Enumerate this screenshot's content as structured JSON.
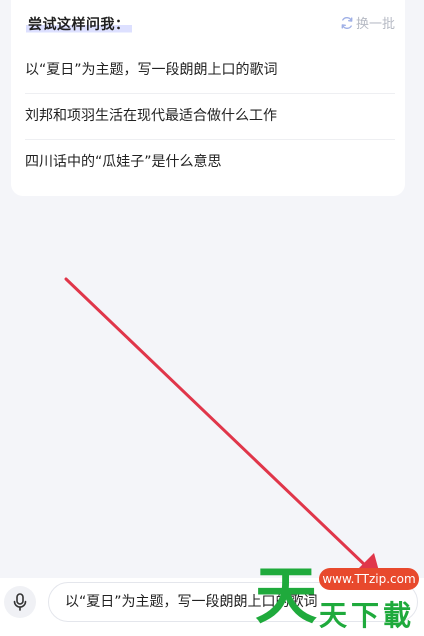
{
  "suggest_card": {
    "title": "尝试这样问我：",
    "refresh_label": "换一批",
    "suggestions": [
      "以“夏日”为主题，写一段朗朗上口的歌词",
      "刘邦和项羽生活在现代最适合做什么工作",
      "四川话中的“瓜娃子”是什么意思"
    ]
  },
  "input_bar": {
    "value": "以“夏日”为主题，写一段朗朗上口的歌词"
  },
  "watermark": {
    "url": "www.TTzip.com",
    "big_char": "天",
    "small_text": "天下載"
  },
  "icons": {
    "refresh": "refresh-icon",
    "microphone": "microphone-icon"
  },
  "colors": {
    "arrow": "#e0364a",
    "watermark_green": "#1faa3c",
    "watermark_badge": "#e8492d",
    "title_highlight": "#dde0ff"
  }
}
